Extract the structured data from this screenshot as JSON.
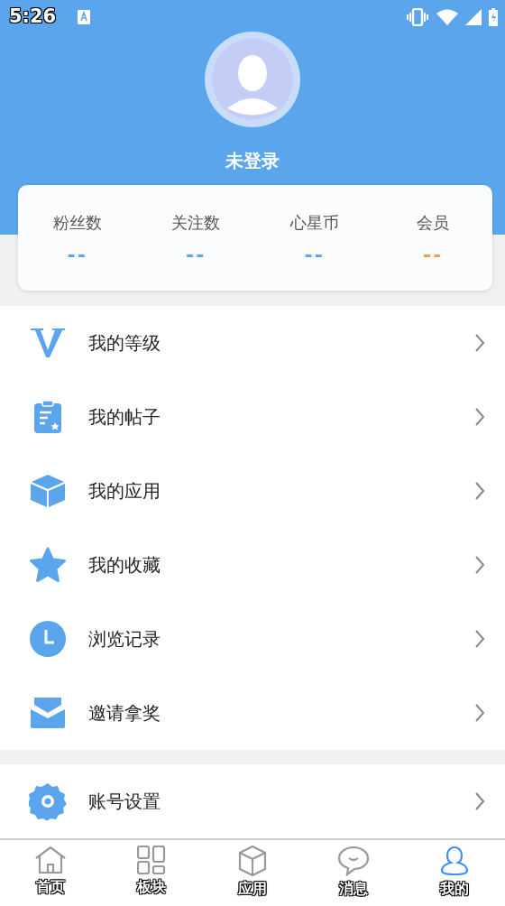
{
  "status_bar": {
    "time": "5:26"
  },
  "profile": {
    "name": "未登录"
  },
  "stats": [
    {
      "label": "粉丝数",
      "value": "--",
      "color": "#5aa5eb"
    },
    {
      "label": "关注数",
      "value": "--",
      "color": "#5aa5eb"
    },
    {
      "label": "心星币",
      "value": "--",
      "color": "#5aa5eb"
    },
    {
      "label": "会员",
      "value": "--",
      "color": "#f0a050"
    }
  ],
  "menu_groups": [
    [
      {
        "label": "我的等级"
      },
      {
        "label": "我的帖子"
      },
      {
        "label": "我的应用"
      },
      {
        "label": "我的收藏"
      },
      {
        "label": "浏览记录"
      },
      {
        "label": "邀请拿奖"
      }
    ],
    [
      {
        "label": "账号设置"
      }
    ]
  ],
  "tab_bar": [
    {
      "label": "首页",
      "selected": false
    },
    {
      "label": "板块",
      "selected": false
    },
    {
      "label": "应用",
      "selected": false
    },
    {
      "label": "消息",
      "selected": false
    },
    {
      "label": "我的",
      "selected": true
    }
  ]
}
